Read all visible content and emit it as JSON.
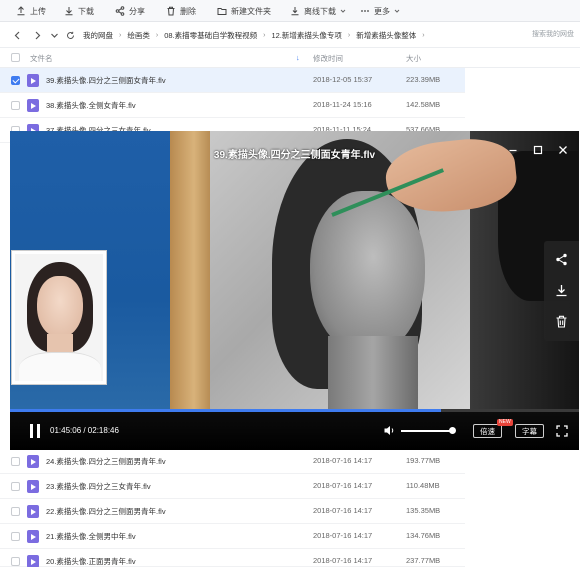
{
  "toolbar": {
    "upload": "上传",
    "download": "下载",
    "share": "分享",
    "delete": "删除",
    "new_folder": "新建文件夹",
    "offline_download": "离线下载",
    "more": "更多"
  },
  "path": {
    "crumbs": [
      "我的网盘",
      "绘画类",
      "08.素描零基础自学教程视频",
      "12.新增素描头像专项",
      "新增素描头像整体"
    ],
    "search_placeholder": "搜索我的网盘"
  },
  "table": {
    "headers": {
      "name": "文件名",
      "modified": "修改时间",
      "size": "大小"
    },
    "top_rows": [
      {
        "name": "39.素描头像.四分之三侧面女青年.flv",
        "time": "2018-12-05 15:37",
        "size": "223.39MB",
        "selected": true
      },
      {
        "name": "38.素描头像.全侧女青年.flv",
        "time": "2018-11-24 15:16",
        "size": "142.58MB",
        "selected": false
      },
      {
        "name": "37.素描头像.四分之三女青年.flv",
        "time": "2018-11-11 15:24",
        "size": "537.66MB",
        "selected": false
      }
    ],
    "bottom_rows": [
      {
        "name": "24.素描头像.四分之三侧面男青年.flv",
        "time": "2018-07-16 14:17",
        "size": "193.77MB",
        "selected": false
      },
      {
        "name": "23.素描头像.四分之三女青年.flv",
        "time": "2018-07-16 14:17",
        "size": "110.48MB",
        "selected": false
      },
      {
        "name": "22.素描头像.四分之三侧面男青年.flv",
        "time": "2018-07-16 14:17",
        "size": "135.35MB",
        "selected": false
      },
      {
        "name": "21.素描头像.全侧男中年.flv",
        "time": "2018-07-16 14:17",
        "size": "134.76MB",
        "selected": false
      },
      {
        "name": "20.素描头像.正面男青年.flv",
        "time": "2018-07-16 14:17",
        "size": "237.77MB",
        "selected": false
      }
    ]
  },
  "player": {
    "title": "39.素描头像.四分之三侧面女青年.flv",
    "current_time": "01:45:06",
    "total_time": "02:18:46",
    "time_display": "01:45:06 / 02:18:46",
    "progress": 0.757,
    "volume": 0.95,
    "speed_label": "倍速",
    "speed_badge": "NEW",
    "subtitle_label": "字幕",
    "accent_color": "#3f7cf0"
  }
}
